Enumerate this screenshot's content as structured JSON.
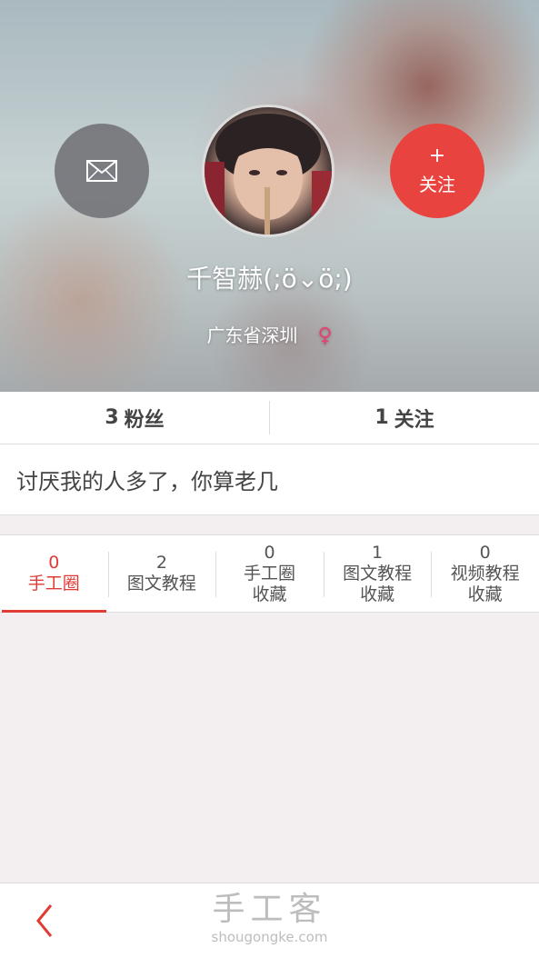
{
  "profile": {
    "username": "千智赫(;ö⌄ö;)",
    "location": "广东省深圳",
    "gender_symbol": "♀"
  },
  "actions": {
    "message_icon": "envelope-icon",
    "follow_plus": "+",
    "follow_label": "关注"
  },
  "stats": [
    {
      "count": "3",
      "label": "粉丝"
    },
    {
      "count": "1",
      "label": "关注"
    }
  ],
  "bio": "讨厌我的人多了，你算老几",
  "tabs": [
    {
      "count": "0",
      "label": "手工圈",
      "active": true
    },
    {
      "count": "2",
      "label": "图文教程"
    },
    {
      "count": "0",
      "label": "手工圈\n收藏"
    },
    {
      "count": "1",
      "label": "图文教程\n收藏"
    },
    {
      "count": "0",
      "label": "视频教程\n收藏"
    }
  ],
  "footer": {
    "watermark_title": "手工客",
    "watermark_url": "shougongke.com"
  },
  "colors": {
    "accent": "#e23b36",
    "follow_button": "#e9433f",
    "gender": "#e8406f"
  }
}
